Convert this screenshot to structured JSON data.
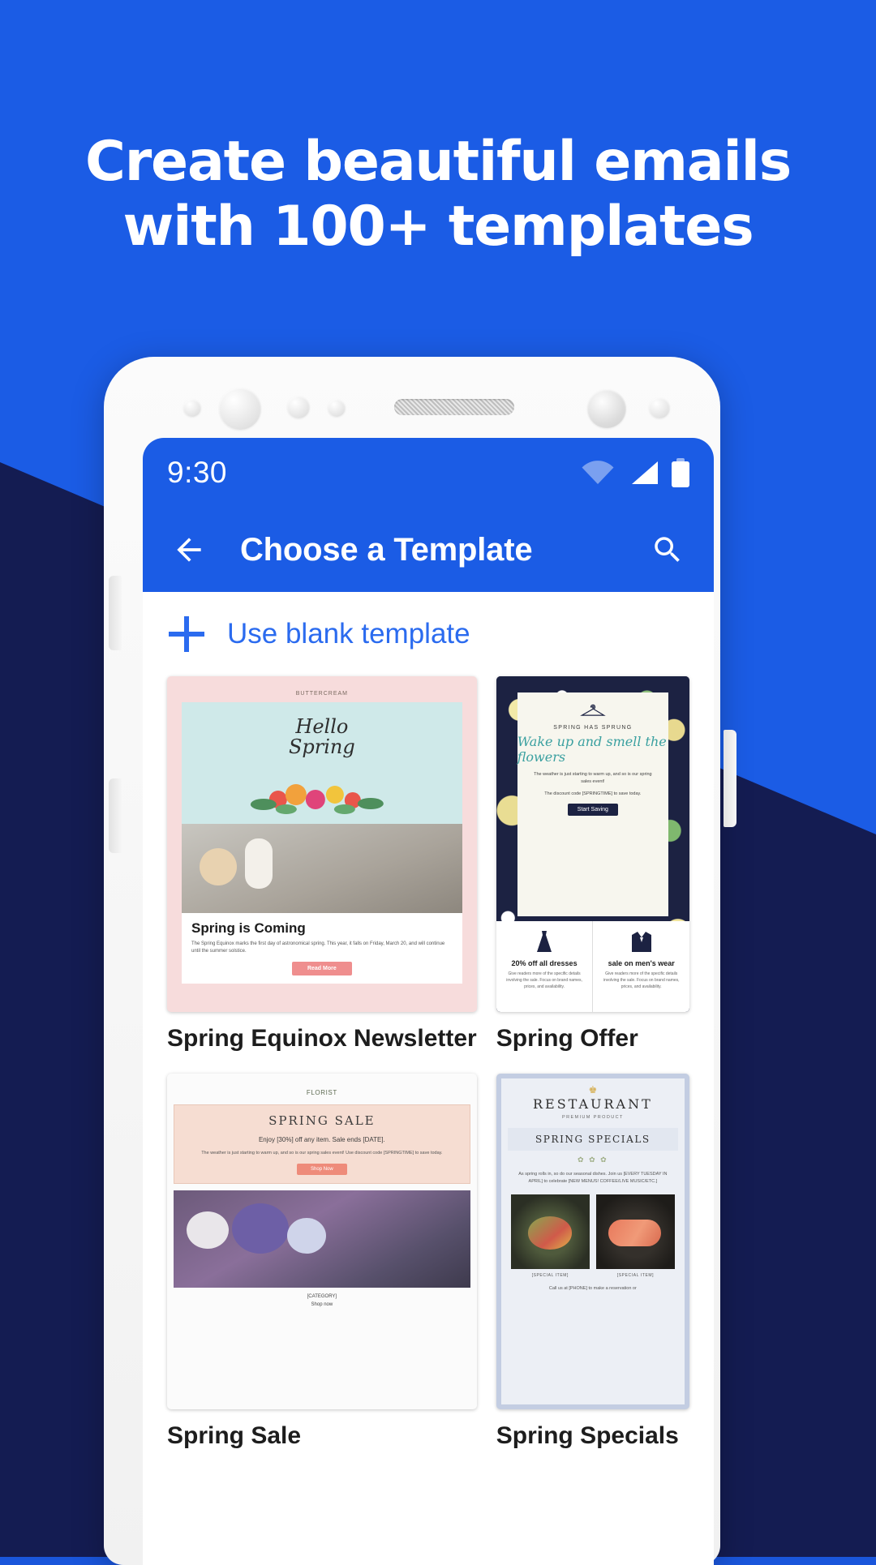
{
  "promo": {
    "headline_line1": "Create beautiful emails",
    "headline_line2": "with 100+ templates",
    "background_color": "#1b5ce5",
    "accent_color": "#17205c"
  },
  "phone": {
    "statusbar": {
      "clock": "9:30",
      "icons": [
        "wifi-icon",
        "signal-icon",
        "battery-icon"
      ]
    },
    "appbar": {
      "back_icon": "arrow-back-icon",
      "title": "Choose a Template",
      "search_icon": "search-icon"
    },
    "blank_template": {
      "plus_icon": "plus-icon",
      "label": "Use blank template"
    },
    "templates": [
      {
        "label": "Spring Equinox Newsletter",
        "preview": {
          "brand": "BUTTERCREAM",
          "hero_line1": "Hello",
          "hero_line2": "Spring",
          "headline": "Spring is Coming",
          "body": "The Spring Equinox marks the first day of astronomical spring. This year, it falls on Friday, March 20, and will continue until the summer solstice.",
          "cta": "Read More"
        }
      },
      {
        "label": "Spring Offer",
        "preview": {
          "kicker": "SPRING HAS SPRUNG",
          "script": "Wake up and smell the flowers",
          "body1": "The weather is just starting to warm up, and so is our spring sales event!",
          "body2": "The discount code [SPRINGTIME] to save today.",
          "cta": "Start Saving",
          "col1_title": "20% off all dresses",
          "col1_text": "Give readers more of the specific details involving the sale. Focus on brand names, prices, and availability.",
          "col2_title": "sale on men's wear",
          "col2_text": "Give readers more of the specific details involving the sale. Focus on brand names, prices, and availability.",
          "col1_icon": "dress-icon",
          "col2_icon": "suit-icon"
        }
      },
      {
        "label": "Spring Sale",
        "preview": {
          "brand": "FLORIST",
          "title": "SPRING SALE",
          "subtitle": "Enjoy [30%] off any item. Sale ends [DATE].",
          "body": "The weather is just starting to warm up, and so is our spring sales event! Use discount code [SPRINGTIME] to save today.",
          "cta": "Shop Now",
          "footer_category": "[CATEGORY]",
          "footer_link": "Shop now"
        }
      },
      {
        "label": "Spring Specials",
        "preview": {
          "crown_icon": "crown-icon",
          "title": "RESTAURANT",
          "subtitle": "PREMIUM PRODUCT",
          "band": "SPRING SPECIALS",
          "body": "As spring rolls in, so do our seasonal dishes. Join us [EVERY TUESDAY IN APRIL] to celebrate [NEW MENUS! COFFEE/LIVE MUSIC/ETC.]",
          "caption1": "[SPECIAL ITEM]",
          "caption2": "[SPECIAL ITEM]",
          "footer": "Call us at [PHONE] to make a reservation or"
        }
      }
    ]
  }
}
